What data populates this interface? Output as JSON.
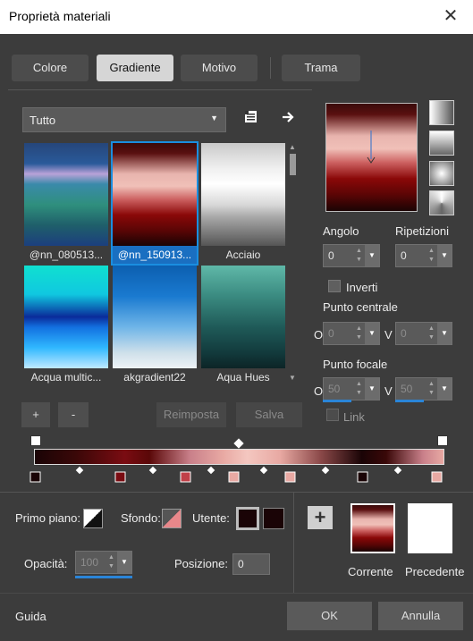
{
  "window": {
    "title": "Proprietà materiali",
    "close_glyph": "✕"
  },
  "tabs": [
    {
      "label": "Colore"
    },
    {
      "label": "Gradiente"
    },
    {
      "label": "Motivo"
    },
    {
      "label": "Trama"
    }
  ],
  "library": {
    "category_value": "Tutto",
    "tiles": [
      {
        "label": "@nn_080513..."
      },
      {
        "label": "@nn_150913..."
      },
      {
        "label": "Acciaio"
      },
      {
        "label": "Acqua multic..."
      },
      {
        "label": "akgradient22"
      },
      {
        "label": "Aqua Hues"
      }
    ],
    "selected_index": 1,
    "add_label": "+",
    "remove_label": "-",
    "reset_label": "Reimposta",
    "save_label": "Salva"
  },
  "gradient_params": {
    "angle_label": "Angolo",
    "angle_value": "0",
    "repeats_label": "Ripetizioni",
    "repeats_value": "0",
    "invert_label": "Inverti",
    "center_label": "Punto centrale",
    "center_o_label": "O",
    "center_o_value": "0",
    "center_v_label": "V",
    "center_v_value": "0",
    "focal_label": "Punto focale",
    "focal_o_label": "O",
    "focal_o_value": "50",
    "focal_v_label": "V",
    "focal_v_value": "50",
    "link_label": "Link"
  },
  "bottom": {
    "foreground_label": "Primo piano:",
    "background_label": "Sfondo:",
    "user_label": "Utente:",
    "opacity_label": "Opacità:",
    "opacity_value": "100",
    "position_label": "Posizione:",
    "position_value": "0",
    "current_label": "Corrente",
    "previous_label": "Precedente",
    "add_glyph": "+"
  },
  "footer": {
    "help_label": "Guida",
    "ok_label": "OK",
    "cancel_label": "Annulla"
  },
  "colors": {
    "accent": "#1a8ee0",
    "dark_red": "#7a0c12",
    "pink": "#e8a9a3",
    "black_brown": "#1a0406"
  }
}
